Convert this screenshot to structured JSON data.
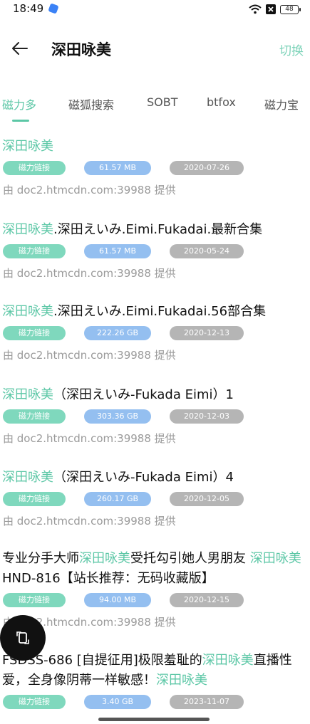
{
  "status_bar": {
    "time": "18:49",
    "battery": "48"
  },
  "header": {
    "title": "深田咏美",
    "switch_label": "切换"
  },
  "tabs": [
    {
      "label": "磁力多",
      "active": true
    },
    {
      "label": "磁狐搜索",
      "active": false
    },
    {
      "label": "SOBT",
      "active": false
    },
    {
      "label": "btfox",
      "active": false
    },
    {
      "label": "磁力宝",
      "active": false
    }
  ],
  "colors": {
    "accent": "#5cc7a6",
    "type_pill": "#7fd8bd",
    "size_pill": "#94bff0",
    "date_pill": "#b5b5b5"
  },
  "results": [
    {
      "title_parts": [
        {
          "t": "深田咏美",
          "hl": true
        }
      ],
      "type": "磁力链接",
      "size": "61.57 MB",
      "date": "2020-07-26",
      "source": "由 doc2.htmcdn.com:39988 提供"
    },
    {
      "title_parts": [
        {
          "t": "深田咏美",
          "hl": true
        },
        {
          "t": ".深田えいみ.Eimi.Fukadai.最新合集",
          "hl": false
        }
      ],
      "type": "磁力链接",
      "size": "61.57 MB",
      "date": "2020-05-24",
      "source": "由 doc2.htmcdn.com:39988 提供"
    },
    {
      "title_parts": [
        {
          "t": "深田咏美",
          "hl": true
        },
        {
          "t": ".深田えいみ.Eimi.Fukadai.56部合集",
          "hl": false
        }
      ],
      "type": "磁力链接",
      "size": "222.26 GB",
      "date": "2020-12-13",
      "source": "由 doc2.htmcdn.com:39988 提供"
    },
    {
      "title_parts": [
        {
          "t": "深田咏美",
          "hl": true
        },
        {
          "t": "（深田えいみ-Fukada Eimi）1",
          "hl": false
        }
      ],
      "type": "磁力链接",
      "size": "303.36 GB",
      "date": "2020-12-03",
      "source": "由 doc2.htmcdn.com:39988 提供"
    },
    {
      "title_parts": [
        {
          "t": "深田咏美",
          "hl": true
        },
        {
          "t": "（深田えいみ-Fukada Eimi）4",
          "hl": false
        }
      ],
      "type": "磁力链接",
      "size": "260.17 GB",
      "date": "2020-12-05",
      "source": "由 doc2.htmcdn.com:39988 提供"
    },
    {
      "title_parts": [
        {
          "t": "专业分手大师",
          "hl": false
        },
        {
          "t": "深田咏美",
          "hl": true
        },
        {
          "t": "受托勾引她人男朋友 ",
          "hl": false
        },
        {
          "t": "深田咏美",
          "hl": true
        },
        {
          "t": " HND-816【站长推荐：无码收藏版】",
          "hl": false
        }
      ],
      "type": "磁力链接",
      "size": "94.00 MB",
      "date": "2020-12-15",
      "source": "由 doc2.htmcdn.com:39988 提供"
    },
    {
      "title_parts": [
        {
          "t": "FSDSS-686 [自提征用]极限羞耻的",
          "hl": false
        },
        {
          "t": "深田咏美",
          "hl": true
        },
        {
          "t": "直播性爱，全身像阴蒂一样敏感！",
          "hl": false
        },
        {
          "t": "深田咏美",
          "hl": true
        }
      ],
      "type": "磁力链接",
      "size": "3.40 GB",
      "date": "2023-11-07",
      "source": ""
    }
  ]
}
